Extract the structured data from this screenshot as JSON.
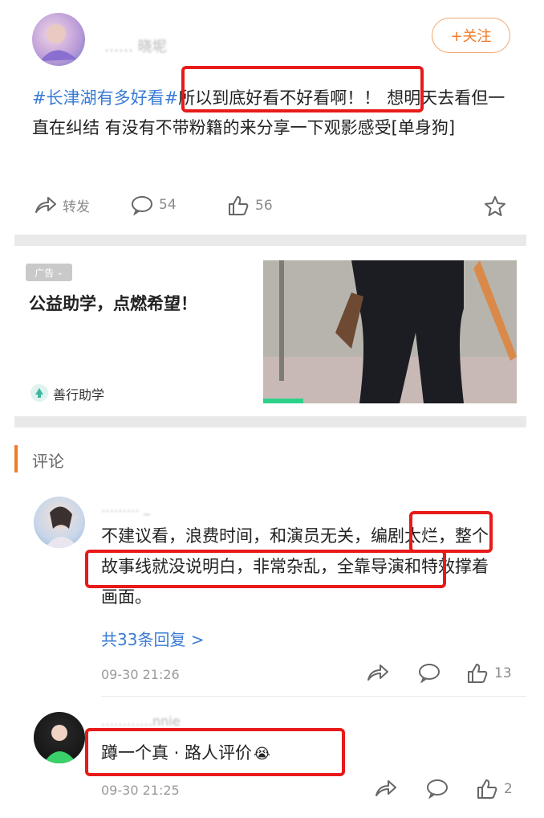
{
  "post": {
    "username": "…… 晓坭",
    "follow_label": "+关注",
    "topic": "#长津湖有多好看#",
    "text_highlight": "所以到底好看不好看啊！！",
    "text_rest": "想明天去看但一直在纠结 有没有不带粉籍的来分享一下观影感受[单身狗]",
    "actions": {
      "repost": "转发",
      "comments": "54",
      "likes": "56"
    }
  },
  "ad": {
    "tag": "广告",
    "title": "公益助学，点燃希望！",
    "brand": "善行助学"
  },
  "comments_section": {
    "title": "评论",
    "comments": [
      {
        "username": "……… _",
        "text_before": "不建议看，浪费时间，和演员无关，",
        "text_highlight_1": "编剧太",
        "text_highlight_2": "烂，整个故事线就没说明白，非常杂乱",
        "text_after": "，全靠导演和特效撑着画面。",
        "more_replies": "共33条回复 >",
        "time": "09-30 21:26",
        "likes": "13"
      },
      {
        "username": "…………nnie",
        "text": "蹲一个真 · 路人评价",
        "emoji": "😭",
        "time": "09-30 21:25",
        "likes": "2"
      }
    ]
  },
  "colors": {
    "accent": "#f07b2a",
    "link": "#3a7bd5",
    "highlight_box": "#e81a1a"
  }
}
